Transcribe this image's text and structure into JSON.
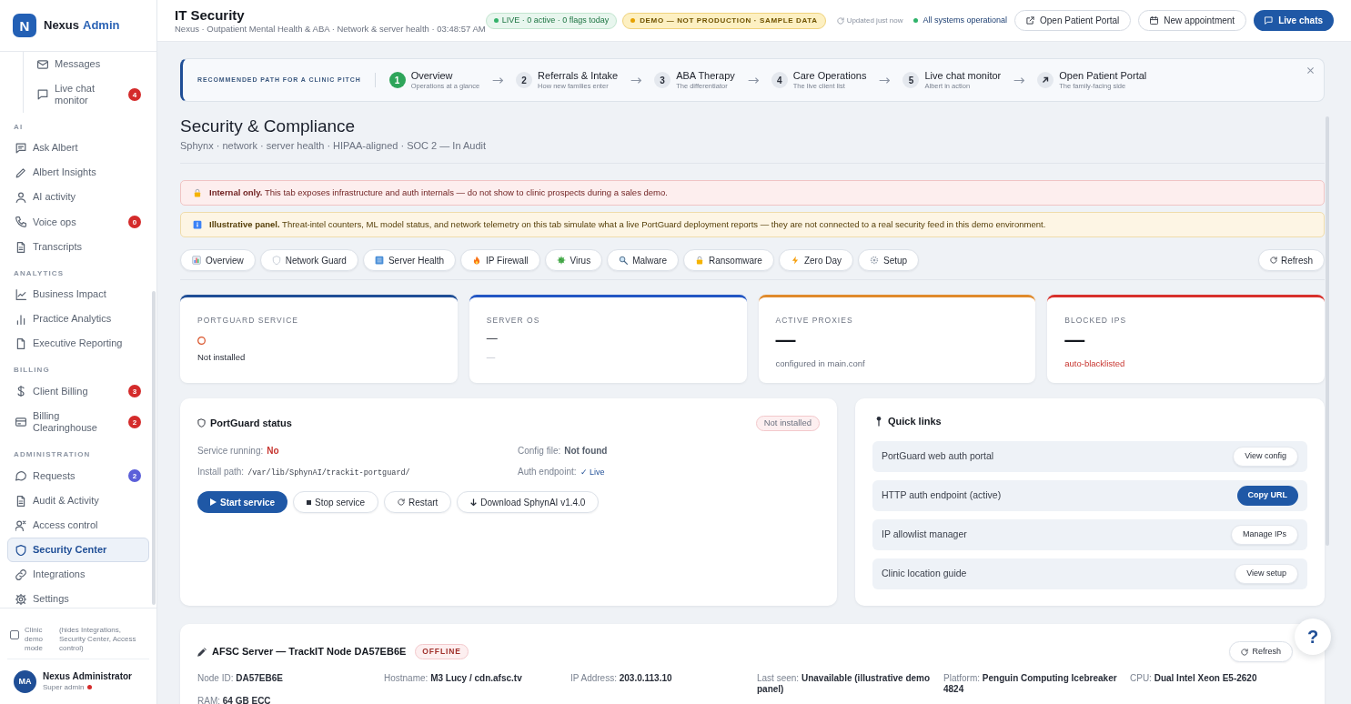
{
  "sidebar": {
    "brand": {
      "mark": "N",
      "name": "Nexus",
      "suffix": "Admin"
    },
    "nested_items": [
      {
        "label": "Messages",
        "selected": false
      },
      {
        "label": "Live chat monitor",
        "selected": false,
        "badge": {
          "text": "4",
          "color": "#d42b2b"
        }
      }
    ],
    "sections": [
      {
        "heading": "AI",
        "items": [
          {
            "label": "Ask Albert",
            "selected": false
          },
          {
            "label": "Albert Insights",
            "selected": false
          },
          {
            "label": "AI activity",
            "selected": false
          },
          {
            "label": "Voice ops",
            "selected": false,
            "badge": {
              "text": "0",
              "color": "#d42b2b"
            }
          },
          {
            "label": "Transcripts",
            "selected": false
          }
        ]
      },
      {
        "heading": "ANALYTICS",
        "items": [
          {
            "label": "Business Impact",
            "selected": false
          },
          {
            "label": "Practice Analytics",
            "selected": false
          },
          {
            "label": "Executive Reporting",
            "selected": false
          }
        ]
      },
      {
        "heading": "BILLING",
        "items": [
          {
            "label": "Client Billing",
            "selected": false,
            "badge": {
              "text": "3",
              "color": "#d42b2b"
            }
          },
          {
            "label": "Billing Clearinghouse",
            "selected": false,
            "badge": {
              "text": "2",
              "color": "#d42b2b"
            }
          }
        ]
      },
      {
        "heading": "ADMINISTRATION",
        "items": [
          {
            "label": "Requests",
            "selected": false,
            "badge": {
              "text": "2",
              "color": "#5b5fd9"
            }
          },
          {
            "label": "Audit & Activity",
            "selected": false
          },
          {
            "label": "Access control",
            "selected": false
          },
          {
            "label": "Security Center",
            "selected": true
          },
          {
            "label": "Integrations",
            "selected": false
          },
          {
            "label": "Settings",
            "selected": false
          }
        ]
      }
    ],
    "demo_mode": {
      "label": "Clinic demo mode",
      "hint": "(hides Integrations, Security Center, Access control)",
      "checked": false
    },
    "user": {
      "initials": "MA",
      "name": "Nexus Administrator",
      "role": "Super admin"
    }
  },
  "header": {
    "title": "IT Security",
    "subtitle": "Nexus · Outpatient Mental Health & ABA · Network & server health · 03:48:57 AM",
    "live_badge": "LIVE · 0 active · 0 flags today",
    "demo_badge": "DEMO — NOT PRODUCTION · SAMPLE DATA",
    "updated": "Updated just now",
    "system_status": "All systems operational",
    "buttons": [
      {
        "label": "Open Patient Portal",
        "primary": false
      },
      {
        "label": "New appointment",
        "primary": false
      },
      {
        "label": "Live chats",
        "primary": true
      }
    ]
  },
  "pitch_path": {
    "label": "RECOMMENDED PATH FOR A CLINIC PITCH",
    "steps": [
      {
        "kind": "number",
        "marker": "1",
        "title": "Overview",
        "subtitle": "Operations at a glance",
        "selected": true
      },
      {
        "kind": "number",
        "marker": "2",
        "title": "Referrals & Intake",
        "subtitle": "How new families enter",
        "selected": false
      },
      {
        "kind": "number",
        "marker": "3",
        "title": "ABA Therapy",
        "subtitle": "The differentiator",
        "selected": false
      },
      {
        "kind": "number",
        "marker": "4",
        "title": "Care Operations",
        "subtitle": "The live client list",
        "selected": false
      },
      {
        "kind": "number",
        "marker": "5",
        "title": "Live chat monitor",
        "subtitle": "Albert in action",
        "selected": false
      },
      {
        "kind": "link",
        "title": "Open Patient Portal",
        "subtitle": "The family-facing side",
        "selected": false
      }
    ]
  },
  "page": {
    "title": "Security & Compliance",
    "subtitle": "Sphynx · network · server health · HIPAA-aligned · SOC 2 — In Audit"
  },
  "alerts": [
    {
      "kind": "danger",
      "text": "**Internal only.** This tab exposes infrastructure and auth internals — do not show to clinic prospects during a sales demo."
    },
    {
      "kind": "info",
      "text": "**Illustrative panel.** Threat-intel counters, ML model status, and network telemetry on this tab simulate what a live PortGuard deployment reports — they are not connected to a real security feed in this demo environment."
    }
  ],
  "tabs": [
    {
      "label": "Overview",
      "selected": false
    },
    {
      "label": "Network Guard",
      "selected": false
    },
    {
      "label": "Server Health",
      "selected": false
    },
    {
      "label": "IP Firewall",
      "selected": false
    },
    {
      "label": "Virus",
      "selected": false
    },
    {
      "label": "Malware",
      "selected": false
    },
    {
      "label": "Ransomware",
      "selected": false
    },
    {
      "label": "Zero Day",
      "selected": false
    },
    {
      "label": "Setup",
      "selected": false
    }
  ],
  "tabs_refresh": "Refresh",
  "stat_cards": [
    {
      "label": "PORTGUARD SERVICE",
      "kind": "status",
      "note": {
        "text": "Not installed",
        "kind": "default"
      },
      "color": "#1f4e96"
    },
    {
      "label": "SERVER OS",
      "kind": "text",
      "value": "—",
      "note": {
        "text": "—",
        "kind": "faint"
      },
      "color": "#2356c4"
    },
    {
      "label": "ACTIVE PROXIES",
      "kind": "count",
      "value": "—",
      "note": {
        "text": "configured in main.conf",
        "kind": "muted"
      },
      "color": "#e08a2c"
    },
    {
      "label": "BLOCKED IPS",
      "kind": "count",
      "value": "—",
      "note": {
        "text": "auto-blacklisted",
        "kind": "danger"
      },
      "color": "#d8302c"
    }
  ],
  "portguard": {
    "title": "PortGuard status",
    "badge": "Not installed",
    "fields": [
      {
        "label": "Service running:",
        "value": "No",
        "kind": "danger"
      },
      {
        "label": "Config file:",
        "value": "Not found",
        "kind": "strong"
      },
      {
        "label": "Install path:",
        "value": "/var/lib/SphynAI/trackit-portguard/",
        "kind": "code"
      },
      {
        "label": "Auth endpoint:",
        "value": "✓ Live",
        "kind": "ok"
      }
    ],
    "actions": [
      {
        "label": "Start service",
        "primary": true
      },
      {
        "label": "Stop service",
        "primary": false
      },
      {
        "label": "Restart",
        "primary": false
      },
      {
        "label": "Download SphynAI v1.4.0",
        "primary": false
      }
    ]
  },
  "quick_links": {
    "title": "Quick links",
    "items": [
      {
        "label": "PortGuard web auth portal",
        "action": "View config",
        "primary": false
      },
      {
        "label": "HTTP auth endpoint (active)",
        "action": "Copy URL",
        "primary": true
      },
      {
        "label": "IP allowlist manager",
        "action": "Manage IPs",
        "primary": false
      },
      {
        "label": "Clinic location guide",
        "action": "View setup",
        "primary": false
      }
    ]
  },
  "server_card": {
    "title": "AFSC Server — TrackIT Node DA57EB6E",
    "status": "OFFLINE",
    "refresh": "Refresh",
    "fields": [
      "Node ID: **DA57EB6E**",
      "Hostname: **M3 Lucy / cdn.afsc.tv**",
      "IP Address: **203.0.113.10**",
      "Last seen: **Unavailable (illustrative demo panel)**",
      "Platform: **Penguin Computing Icebreaker 4824**",
      "CPU: **Dual Intel Xeon E5-2620**",
      "RAM: **64 GB ECC**"
    ]
  },
  "help": "?"
}
